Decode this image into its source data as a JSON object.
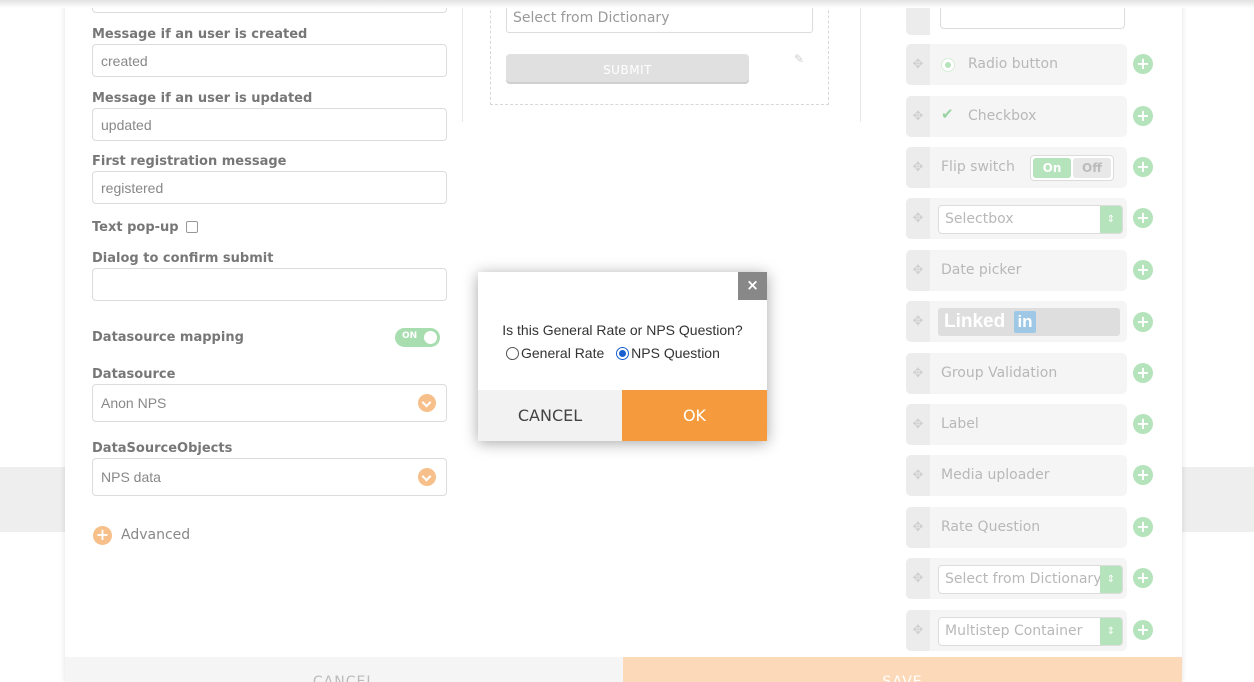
{
  "form": {
    "msg_created_label": "Message if an user is created",
    "msg_created_value": "created",
    "msg_updated_label": "Message if an user is updated",
    "msg_updated_value": "updated",
    "first_reg_label": "First registration message",
    "first_reg_value": "registered",
    "text_popup_label": "Text pop-up",
    "text_popup_checked": false,
    "dialog_confirm_label": "Dialog to confirm submit",
    "dialog_confirm_value": "",
    "datasource_mapping_label": "Datasource mapping",
    "datasource_mapping_toggle": "ON",
    "datasource_label": "Datasource",
    "datasource_value": "Anon NPS",
    "datasource_objects_label": "DataSourceObjects",
    "datasource_objects_value": "NPS data",
    "advanced_label": "Advanced"
  },
  "preview": {
    "select_placeholder": "Select from Dictionary",
    "submit_label": "SUBMIT"
  },
  "components": {
    "radio": "Radio button",
    "checkbox": "Checkbox",
    "flip_switch": "Flip switch",
    "flip_on": "On",
    "flip_off": "Off",
    "selectbox": "Selectbox",
    "date_picker": "Date picker",
    "linkedin_text": "Linked",
    "linkedin_in": "in",
    "group_validation": "Group Validation",
    "label": "Label",
    "media_uploader": "Media uploader",
    "rate_question": "Rate Question",
    "select_dictionary": "Select from Dictionary",
    "multistep": "Multistep Container"
  },
  "bottom": {
    "cancel": "CANCEL",
    "save": "SAVE"
  },
  "modal": {
    "close": "×",
    "question": "Is this General Rate or NPS Question?",
    "option_general": "General Rate",
    "option_nps": "NPS Question",
    "selected": "NPS Question",
    "cancel": "CANCEL",
    "ok": "OK"
  },
  "colors": {
    "accent": "#f59b3d",
    "green": "#b5e3bb"
  }
}
